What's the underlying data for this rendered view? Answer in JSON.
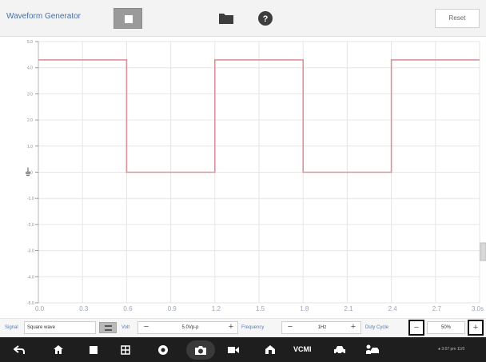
{
  "toolbar": {
    "title": "Waveform Generator",
    "reset_label": "Reset"
  },
  "plot": {
    "y_ticks": [
      "5.0",
      "4.0",
      "3.0",
      "2.0",
      "1.0",
      "0.0",
      "-1.0",
      "-2.0",
      "-3.0",
      "-4.0",
      "-5.0"
    ],
    "x_ticks": [
      "0.0",
      "0.3",
      "0.6",
      "0.9",
      "1.2",
      "1.5",
      "1.8",
      "2.1",
      "2.4",
      "2.7",
      "3.0s"
    ],
    "trace_color": "#d9949b",
    "chart_data": {
      "type": "line",
      "xlabel": "",
      "ylabel": "",
      "x_unit": "s",
      "xlim": [
        0,
        3.0
      ],
      "ylim": [
        -5,
        5
      ],
      "grid": true,
      "series": [
        {
          "x": [
            0,
            0.6,
            0.6,
            1.2,
            1.2,
            1.8,
            1.8,
            2.4,
            2.4,
            3.0
          ],
          "y": [
            4.3,
            4.3,
            0.0,
            0.0,
            4.3,
            4.3,
            0.0,
            0.0,
            4.3,
            4.3
          ]
        }
      ]
    }
  },
  "controls": {
    "signal_label": "Signal",
    "signal_value": "Square wave",
    "volt_label": "Volt",
    "volt_value": "5.0Vp-p",
    "frequency_label": "Frequency",
    "frequency_value": "1Hz",
    "duty_label": "Duty Cycle",
    "duty_value": "50%",
    "minus": "−",
    "plus": "+"
  },
  "navbar": {
    "vcmi_label": "VCMI",
    "status_text": "● 3:07 pm 11/0"
  },
  "icons": {
    "back": "back-arrow-icon",
    "home": "home-icon",
    "recents": "recents-icon",
    "grid": "grid-icon",
    "chrome": "browser-icon",
    "camera": "camera-icon",
    "video": "video-icon",
    "house": "autel-home-icon",
    "car": "car-icon",
    "car_tools": "car-diagnose-icon"
  }
}
